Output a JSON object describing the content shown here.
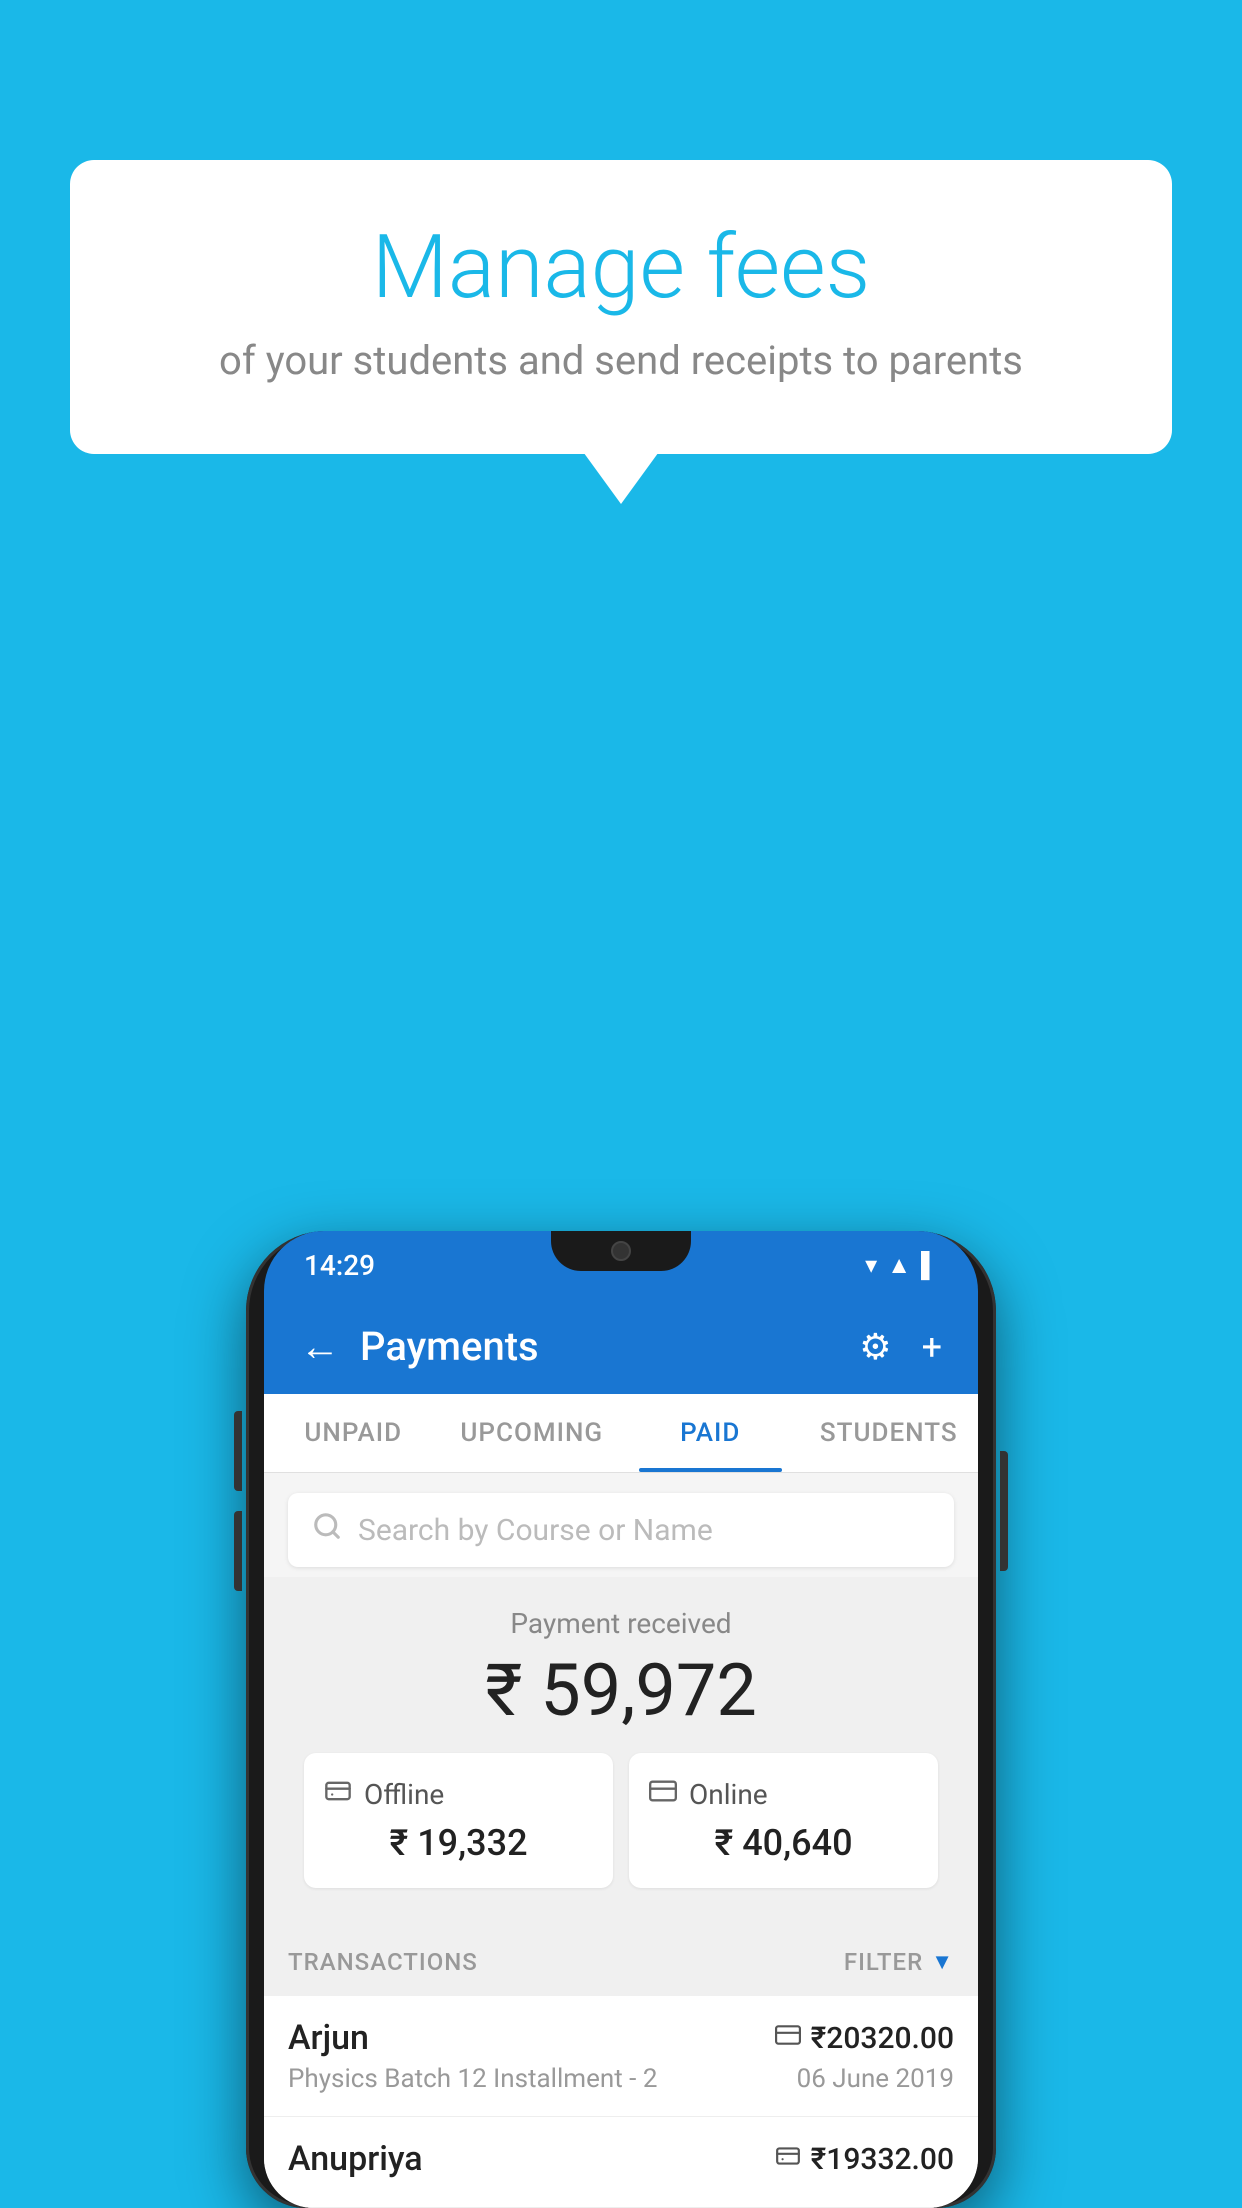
{
  "background_color": "#1ab8e8",
  "bubble": {
    "title": "Manage fees",
    "subtitle": "of your students and send receipts to parents"
  },
  "phone": {
    "status_bar": {
      "time": "14:29",
      "icons": [
        "▼",
        "▲",
        "▌"
      ]
    },
    "header": {
      "back_icon": "←",
      "title": "Payments",
      "gear_icon": "⚙",
      "plus_icon": "+"
    },
    "tabs": [
      {
        "label": "UNPAID",
        "active": false
      },
      {
        "label": "UPCOMING",
        "active": false
      },
      {
        "label": "PAID",
        "active": true
      },
      {
        "label": "STUDENTS",
        "active": false
      }
    ],
    "search": {
      "placeholder": "Search by Course or Name"
    },
    "payment_summary": {
      "label": "Payment received",
      "amount": "₹ 59,972",
      "offline": {
        "label": "Offline",
        "amount": "₹ 19,332"
      },
      "online": {
        "label": "Online",
        "amount": "₹ 40,640"
      }
    },
    "transactions": {
      "header_label": "TRANSACTIONS",
      "filter_label": "FILTER",
      "items": [
        {
          "name": "Arjun",
          "course": "Physics Batch 12 Installment - 2",
          "amount": "₹20320.00",
          "date": "06 June 2019",
          "payment_type": "online"
        },
        {
          "name": "Anupriya",
          "course": "",
          "amount": "₹19332.00",
          "date": "",
          "payment_type": "offline"
        }
      ]
    }
  }
}
